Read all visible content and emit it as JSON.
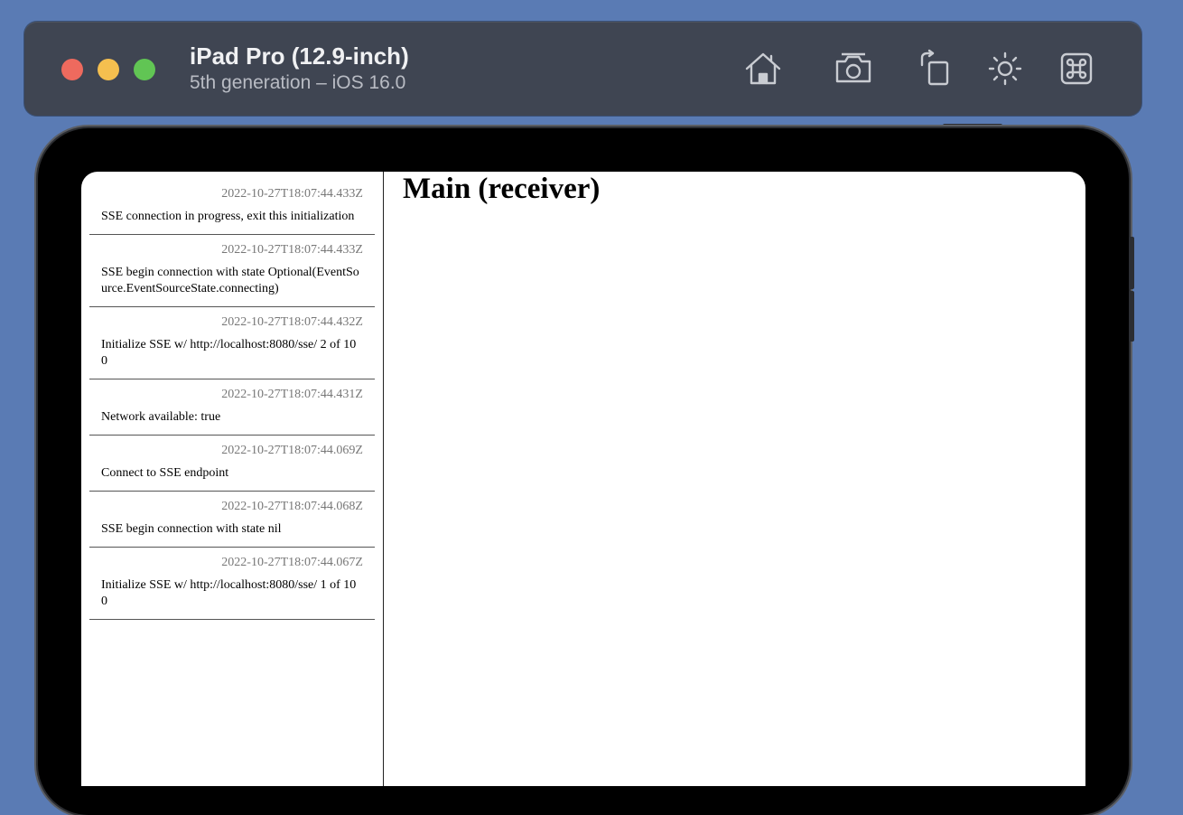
{
  "simulator": {
    "device_name": "iPad Pro (12.9-inch)",
    "device_subtitle": "5th generation – iOS 16.0"
  },
  "toolbar": {
    "icons": [
      "home-icon",
      "screenshot-icon",
      "rotate-icon",
      "appearance-icon",
      "command-icon"
    ]
  },
  "main": {
    "title": "Main (receiver)"
  },
  "log": [
    {
      "time": "2022-10-27T18:07:44.433Z",
      "message": "SSE connection in progress, exit this initialization"
    },
    {
      "time": "2022-10-27T18:07:44.433Z",
      "message": "SSE begin connection with state Optional(EventSource.EventSourceState.connecting)"
    },
    {
      "time": "2022-10-27T18:07:44.432Z",
      "message": "Initialize SSE w/ http://localhost:8080/sse/ 2 of 10 0"
    },
    {
      "time": "2022-10-27T18:07:44.431Z",
      "message": "Network available: true"
    },
    {
      "time": "2022-10-27T18:07:44.069Z",
      "message": "Connect to SSE endpoint"
    },
    {
      "time": "2022-10-27T18:07:44.068Z",
      "message": "SSE begin connection with state nil"
    },
    {
      "time": "2022-10-27T18:07:44.067Z",
      "message": "Initialize SSE w/ http://localhost:8080/sse/ 1 of 10 0"
    }
  ]
}
